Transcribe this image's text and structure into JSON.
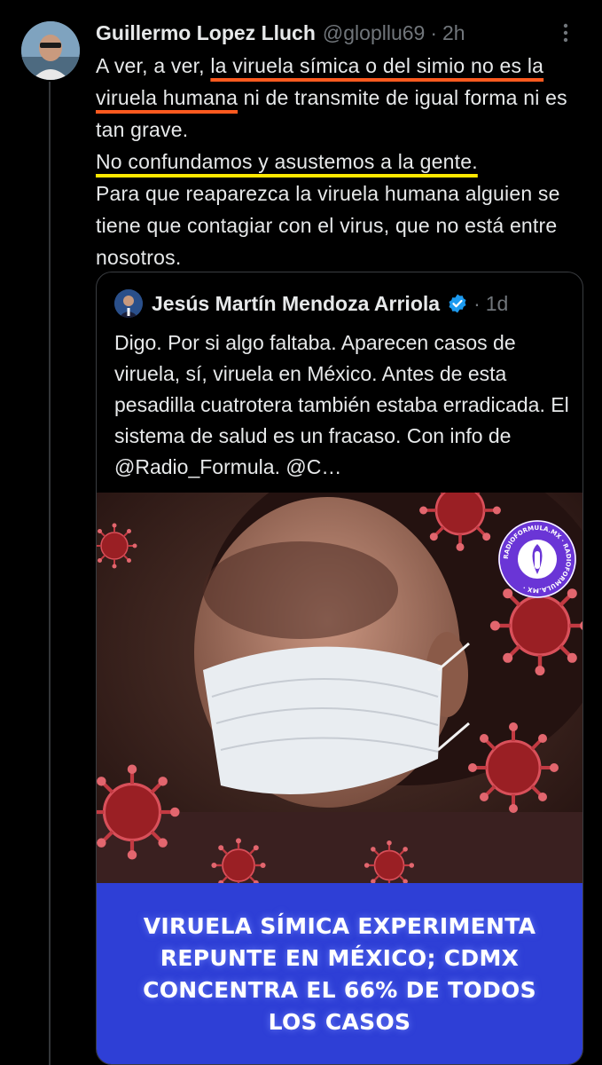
{
  "tweet": {
    "author_name": "Guillermo Lopez Lluch",
    "handle": "@glopllu69",
    "separator": "·",
    "time": "2h",
    "text": {
      "p1_a": "A ver, a ver, ",
      "p1_highlight": "la viruela símica o del simio no es la viruela humana",
      "p1_b": " ni de transmite de igual forma ni es tan grave.",
      "p2_highlight": "No confundamos y asustemos a la gente.",
      "p3": "Para que reaparezca la viruela humana alguien se tiene que contagiar con el virus, que no está entre nosotros."
    }
  },
  "quoted_tweet": {
    "author_name": "Jesús Martín Mendoza Arriola",
    "separator": "·",
    "time": "1d",
    "text": "Digo. Por si algo faltaba. Aparecen casos de viruela, sí, viruela en México. Antes de esta pesadilla cuatrotera también estaba erradicada. El sistema de salud es un fracaso. Con info de @Radio_Formula. @C…",
    "media": {
      "headline": "VIRUELA SÍMICA EXPERIMENTA REPUNTE EN MÉXICO; CDMX CONCENTRA EL 66% DE TODOS LOS CASOS",
      "logo_ring_text": "RADIOFORMULA.MX · RADIOFORMULA.MX ·"
    }
  },
  "colors": {
    "highlight_orange": "#ff5a1f",
    "highlight_yellow": "#ffe800",
    "verified_blue": "#1d9bf0",
    "banner_blue": "#2e3fd6"
  }
}
